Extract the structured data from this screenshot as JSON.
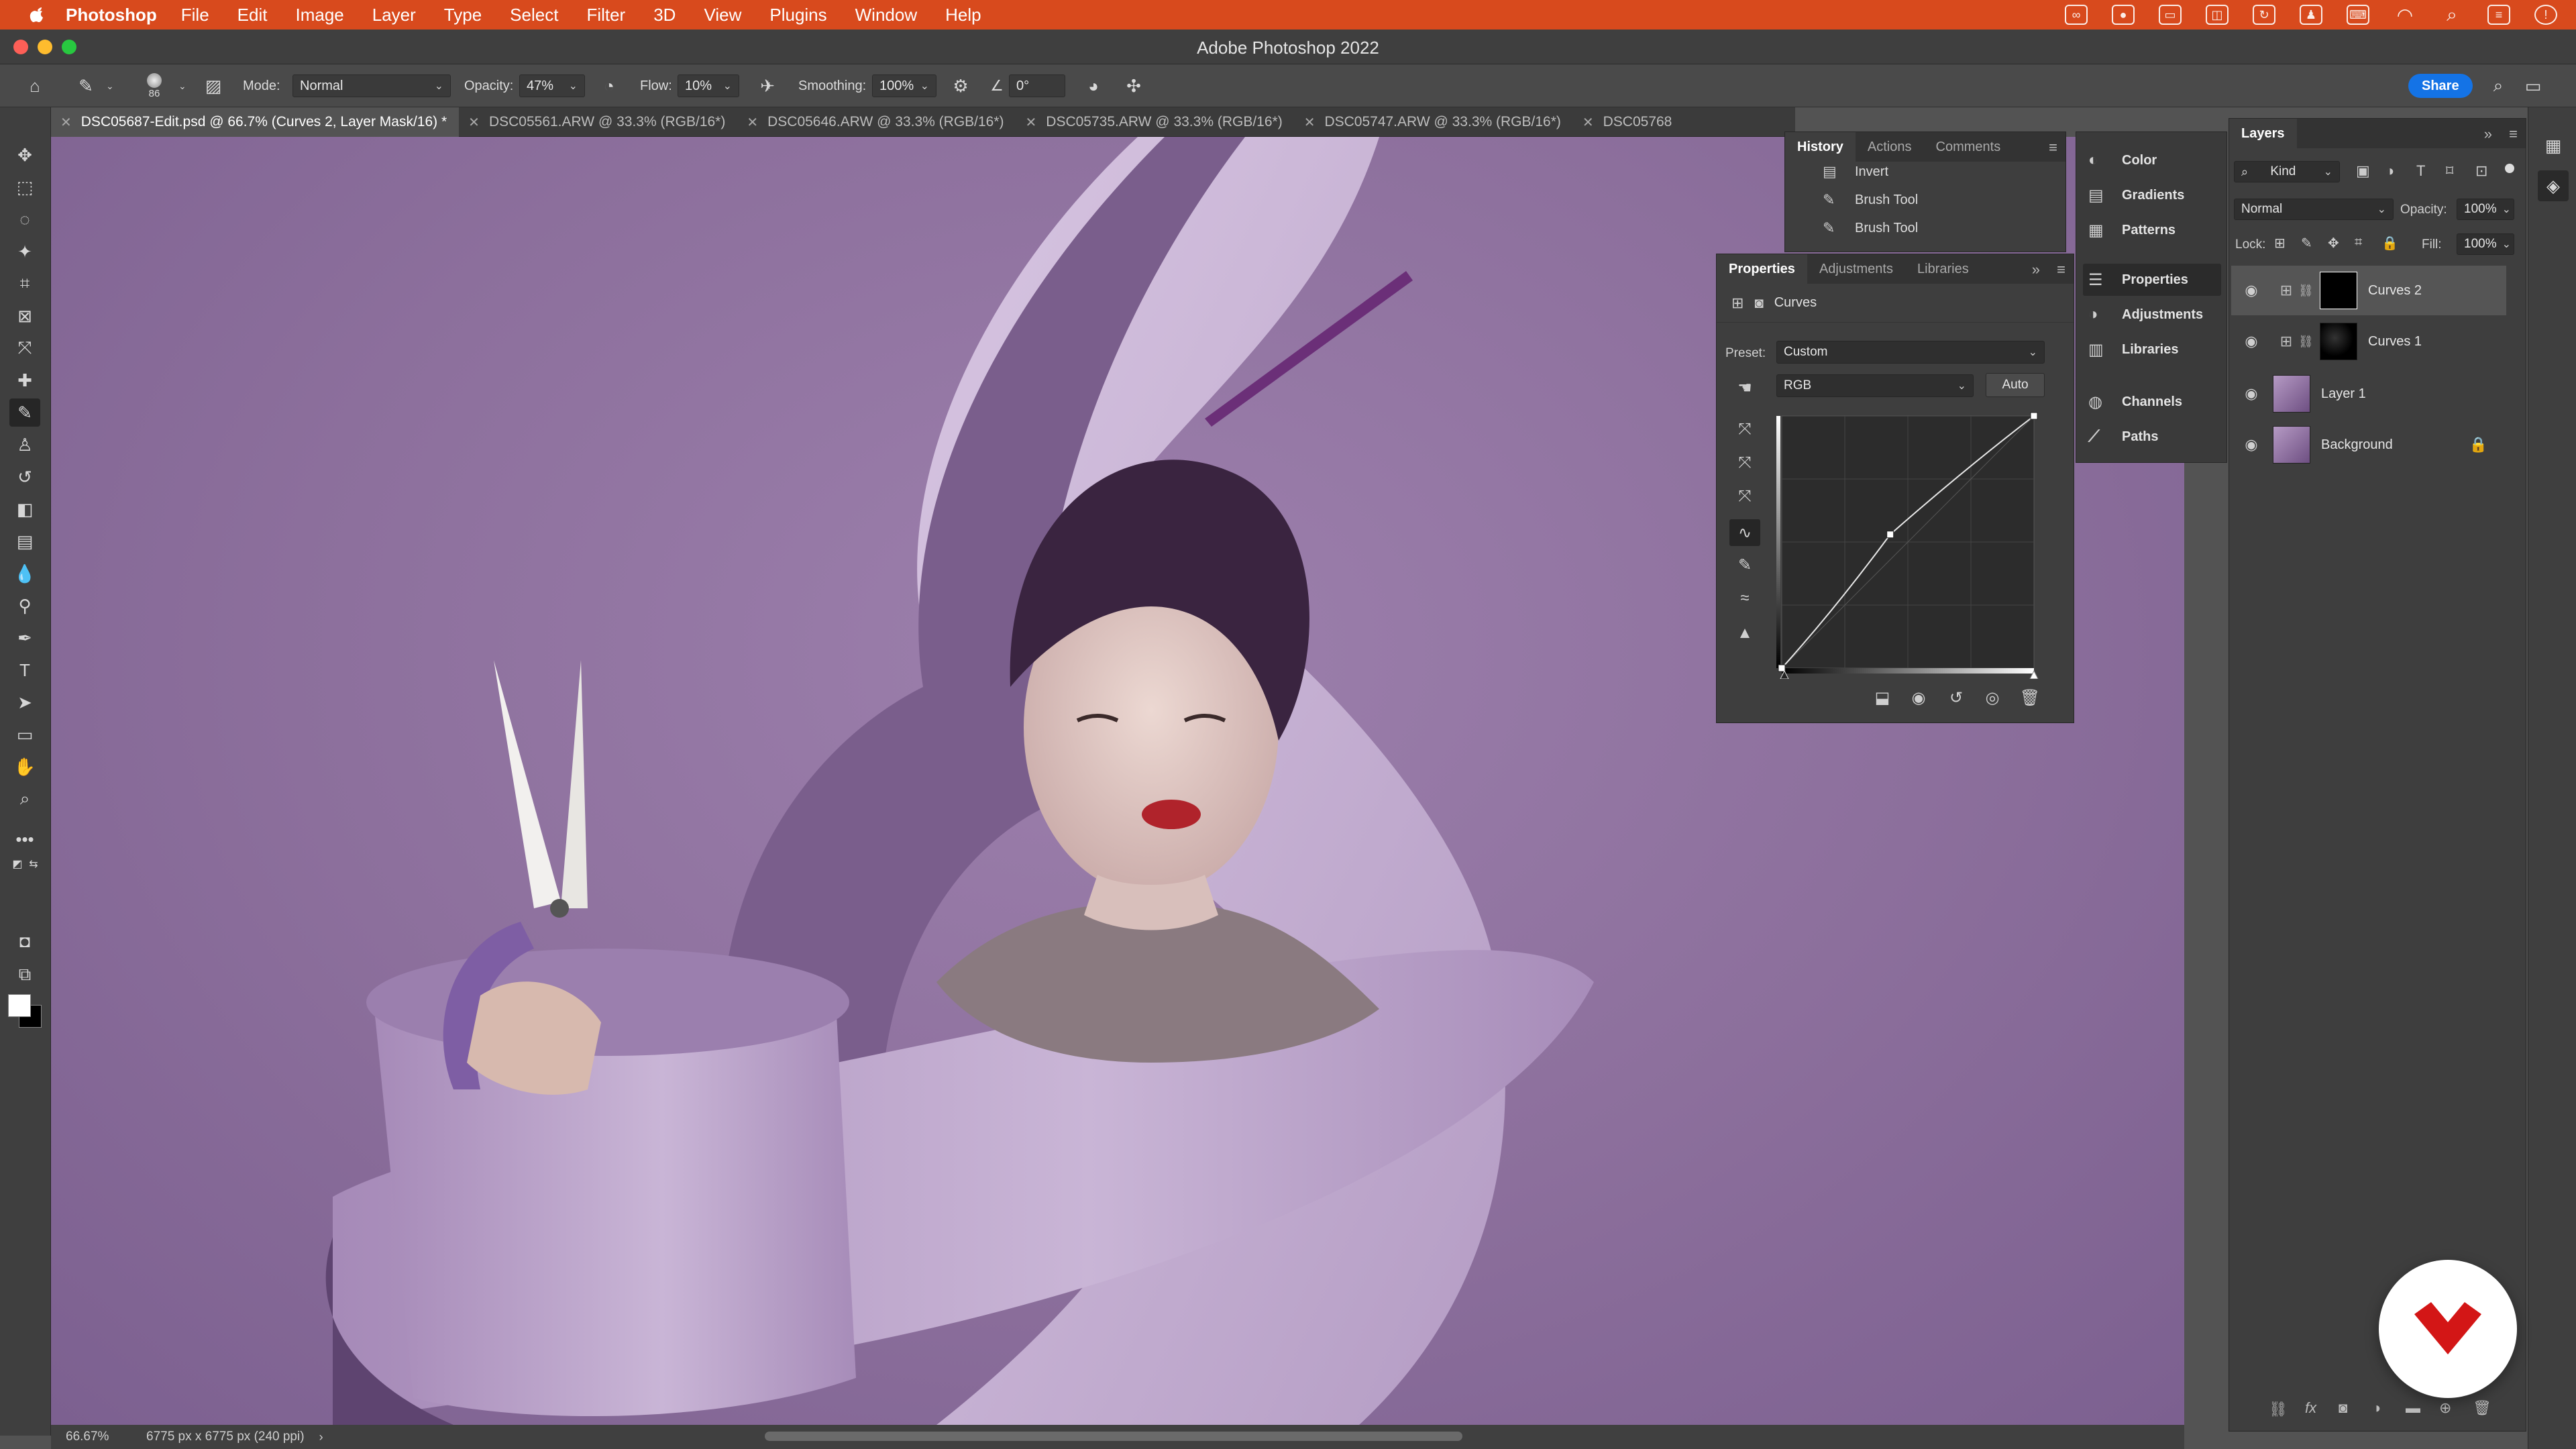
{
  "menubar": {
    "app_name": "Photoshop",
    "items": [
      "File",
      "Edit",
      "Image",
      "Layer",
      "Type",
      "Select",
      "Filter",
      "3D",
      "View",
      "Plugins",
      "Window",
      "Help"
    ]
  },
  "window": {
    "title": "Adobe Photoshop 2022"
  },
  "options_bar": {
    "brush_size": "86",
    "mode_label": "Mode:",
    "mode_value": "Normal",
    "opacity_label": "Opacity:",
    "opacity_value": "47%",
    "flow_label": "Flow:",
    "flow_value": "10%",
    "smoothing_label": "Smoothing:",
    "smoothing_value": "100%",
    "angle_value": "0°",
    "share_label": "Share"
  },
  "tabs": [
    {
      "label": "DSC05687-Edit.psd @ 66.7% (Curves 2, Layer Mask/16) *",
      "active": true
    },
    {
      "label": "DSC05561.ARW @ 33.3% (RGB/16*)",
      "active": false
    },
    {
      "label": "DSC05646.ARW @ 33.3% (RGB/16*)",
      "active": false
    },
    {
      "label": "DSC05735.ARW @ 33.3% (RGB/16*)",
      "active": false
    },
    {
      "label": "DSC05747.ARW @ 33.3% (RGB/16*)",
      "active": false
    },
    {
      "label": "DSC05768",
      "active": false
    }
  ],
  "history_panel": {
    "tabs": [
      "History",
      "Actions",
      "Comments"
    ],
    "items": [
      "Invert",
      "Brush Tool",
      "Brush Tool"
    ]
  },
  "properties_panel": {
    "tabs": [
      "Properties",
      "Adjustments",
      "Libraries"
    ],
    "title": "Curves",
    "preset_label": "Preset:",
    "preset_value": "Custom",
    "channel_value": "RGB",
    "auto_label": "Auto",
    "curve_points": [
      [
        0,
        0
      ],
      [
        0.43,
        0.53
      ],
      [
        1,
        1
      ]
    ]
  },
  "dock_panels": {
    "items": [
      "Color",
      "Gradients",
      "Patterns",
      "Properties",
      "Adjustments",
      "Libraries",
      "Channels",
      "Paths"
    ]
  },
  "layers_panel": {
    "title": "Layers",
    "filter_value": "Kind",
    "blend_mode": "Normal",
    "opacity_label": "Opacity:",
    "opacity_value": "100%",
    "lock_label": "Lock:",
    "fill_label": "Fill:",
    "fill_value": "100%",
    "layers": [
      {
        "name": "Curves 2",
        "selected": true
      },
      {
        "name": "Curves 1",
        "selected": false
      },
      {
        "name": "Layer 1",
        "selected": false
      },
      {
        "name": "Background",
        "selected": false
      }
    ]
  },
  "status": {
    "zoom": "66.67%",
    "dimensions": "6775 px x 6775 px (240 ppi)"
  },
  "colors": {
    "menubar": "#d84a1d",
    "accent": "#1473e6",
    "canvas_bg": "#8c6f9c"
  }
}
